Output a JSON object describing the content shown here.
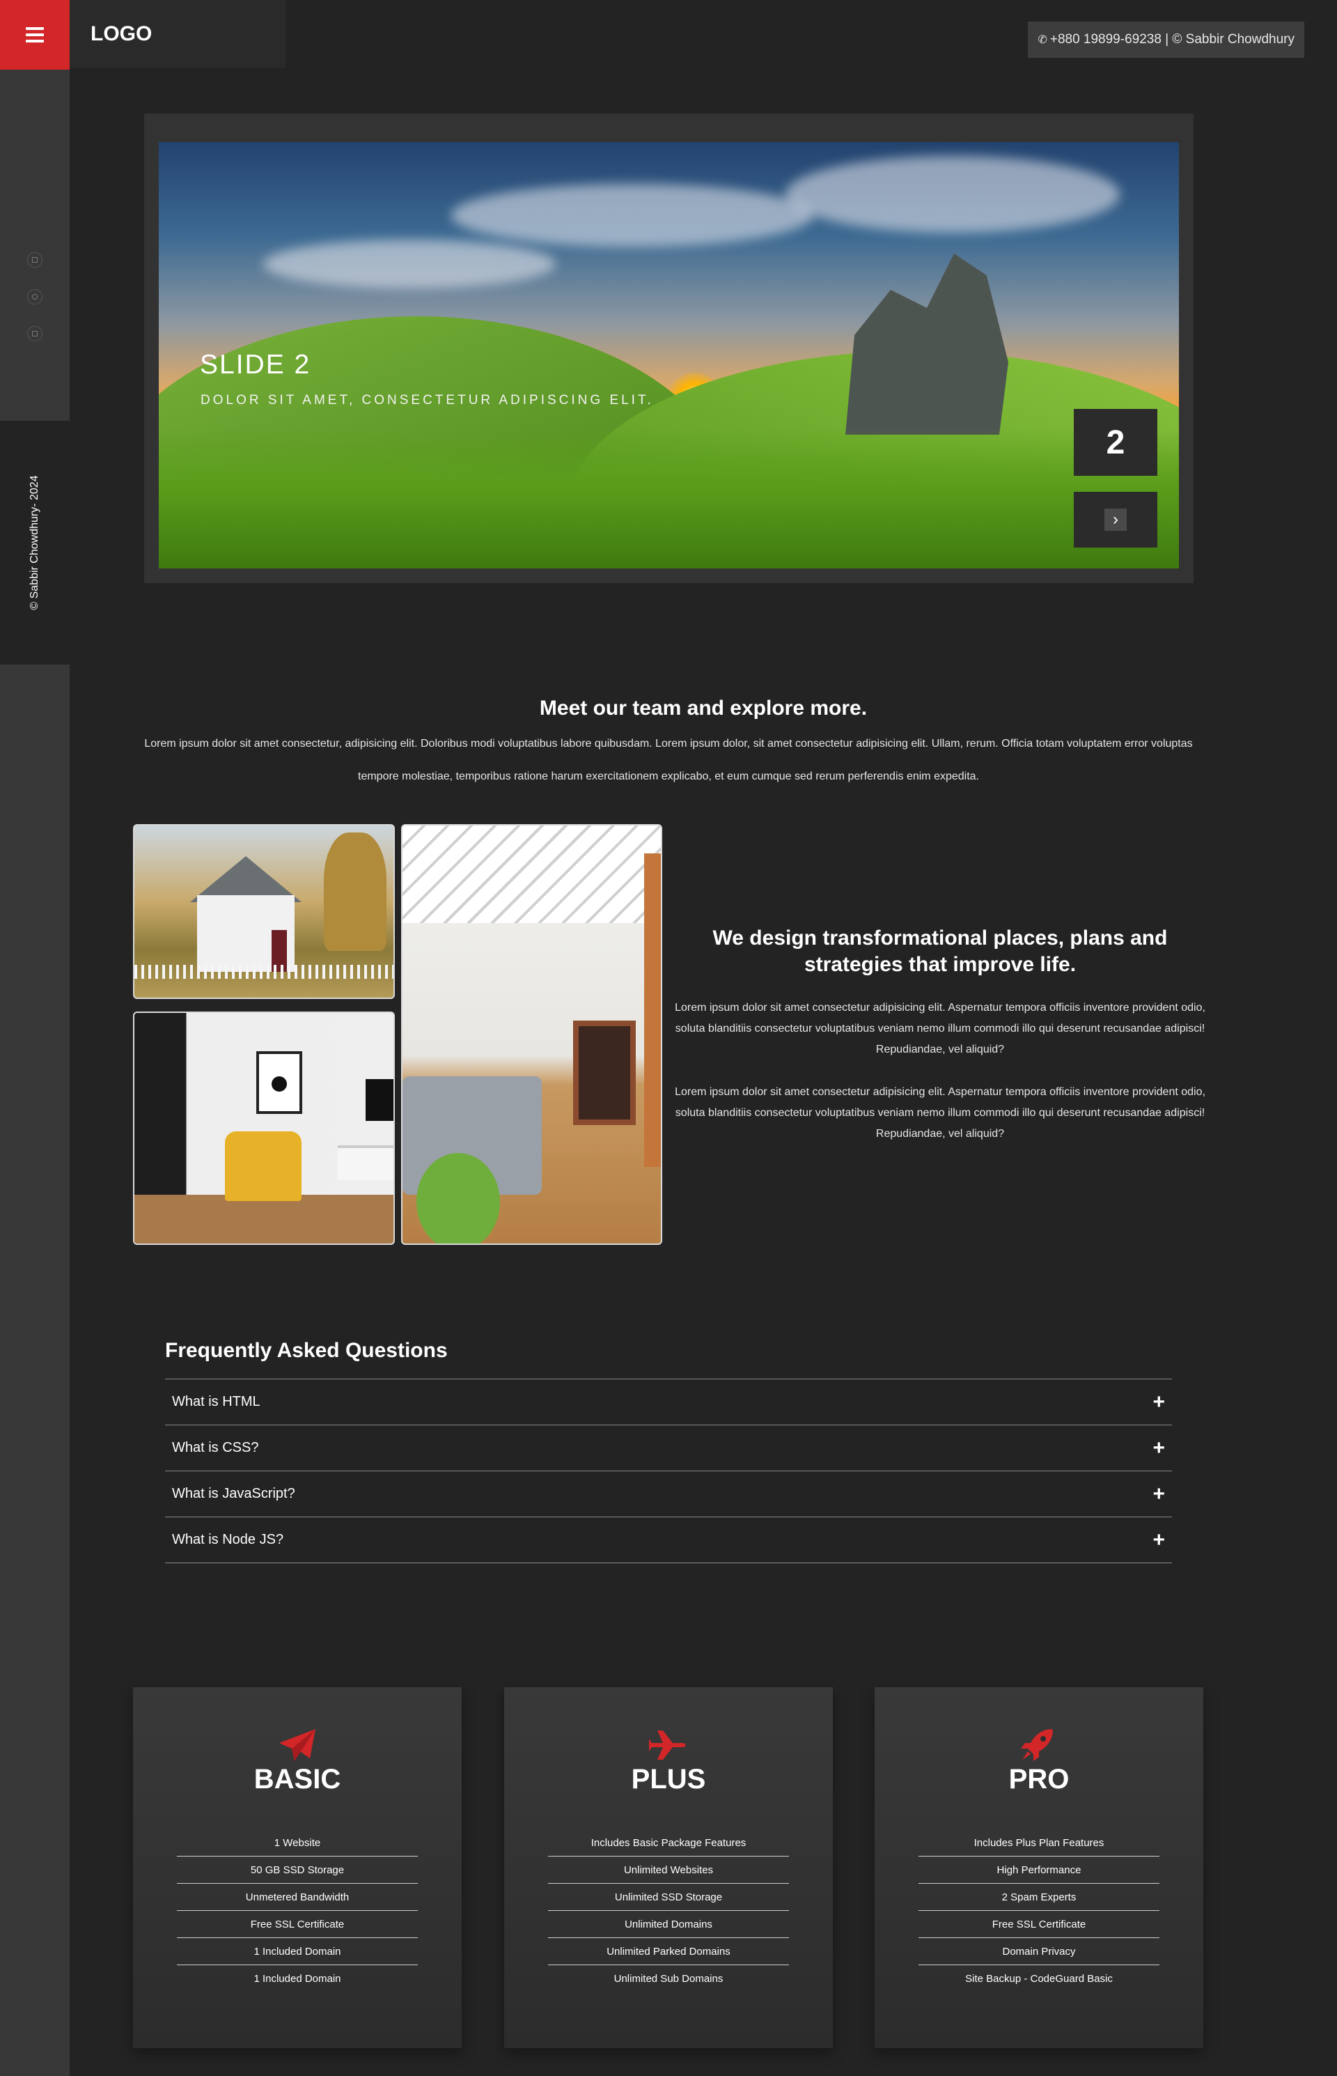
{
  "header": {
    "logo": "LOGO",
    "contact": "+880 19899-69238 | © Sabbir Chowdhury",
    "phone_icon": "phone-icon"
  },
  "sidebar": {
    "menu_icon": "hamburger-icon",
    "social_icons": [
      "facebook-icon",
      "instagram-icon",
      "linkedin-icon"
    ],
    "copyright": "© Sabbir Chowdhury- 2024"
  },
  "slider": {
    "title": "SLIDE 2",
    "subtitle": "DOLOR SIT AMET, CONSECTETUR ADIPISCING ELIT.",
    "number": "2",
    "next_icon": "chevron-right-icon",
    "next_glyph": "›"
  },
  "team": {
    "title": "Meet our team and explore more.",
    "text": "Lorem ipsum dolor sit amet consectetur, adipisicing elit. Doloribus modi voluptatibus labore quibusdam. Lorem ipsum dolor, sit amet consectetur adipisicing elit. Ullam, rerum. Officia totam voluptatem error voluptas tempore molestiae, temporibus ratione harum exercitationem explicabo, et eum cumque sed rerum perferendis enim expedita."
  },
  "design": {
    "title": "We design transformational places, plans and strategies that improve life.",
    "p1": "Lorem ipsum dolor sit amet consectetur adipisicing elit. Aspernatur tempora officiis inventore provident odio, soluta blanditiis consectetur voluptatibus veniam nemo illum commodi illo qui deserunt recusandae adipisci! Repudiandae, vel aliquid?",
    "p2": "Lorem ipsum dolor sit amet consectetur adipisicing elit. Aspernatur tempora officiis inventore provident odio, soluta blanditiis consectetur voluptatibus veniam nemo illum commodi illo qui deserunt recusandae adipisci! Repudiandae, vel aliquid?"
  },
  "faq": {
    "title": "Frequently Asked Questions",
    "plus": "+",
    "items": [
      {
        "q": "What is HTML"
      },
      {
        "q": "What is CSS?"
      },
      {
        "q": "What is JavaScript?"
      },
      {
        "q": "What is Node JS?"
      }
    ]
  },
  "pricing": {
    "accent": "#d32629",
    "cards": [
      {
        "name": "BASIC",
        "icon": "paper-plane-icon",
        "features": [
          "1 Website",
          "50 GB SSD Storage",
          "Unmetered Bandwidth",
          "Free SSL Certificate",
          "1 Included Domain",
          "1 Included Domain"
        ]
      },
      {
        "name": "PLUS",
        "icon": "airplane-icon",
        "features": [
          "Includes Basic Package Features",
          "Unlimited Websites",
          "Unlimited SSD Storage",
          "Unlimited Domains",
          "Unlimited Parked Domains",
          "Unlimited Sub Domains"
        ]
      },
      {
        "name": "PRO",
        "icon": "rocket-icon",
        "features": [
          "Includes Plus Plan Features",
          "High Performance",
          "2 Spam Experts",
          "Free SSL Certificate",
          "Domain Privacy",
          "Site Backup - CodeGuard Basic"
        ]
      }
    ]
  }
}
